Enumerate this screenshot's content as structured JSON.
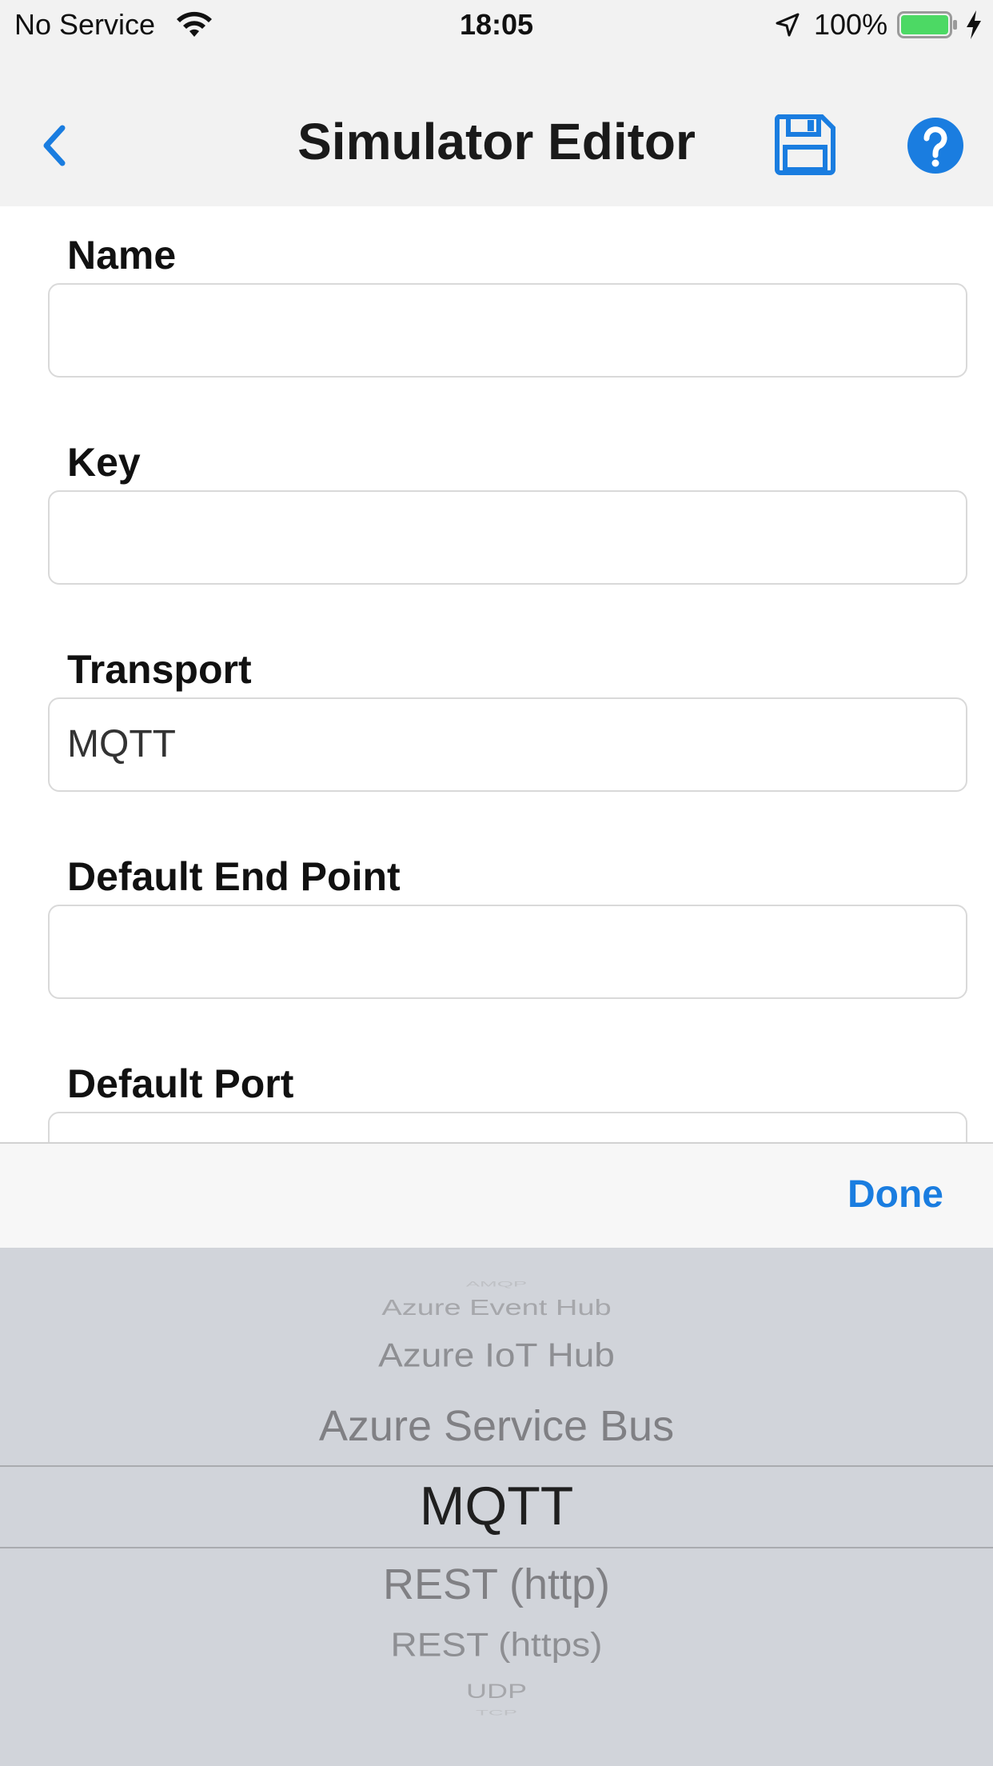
{
  "status_bar": {
    "carrier": "No Service",
    "time": "18:05",
    "battery_percent": "100%",
    "battery_color": "#4cd964"
  },
  "nav": {
    "title": "Simulator Editor",
    "back_icon": "chevron-left-icon",
    "save_icon": "floppy-disk-icon",
    "help_icon": "question-circle-icon",
    "accent_color": "#1a7de0"
  },
  "form": {
    "fields": [
      {
        "label": "Name",
        "value": ""
      },
      {
        "label": "Key",
        "value": ""
      },
      {
        "label": "Transport",
        "value": "MQTT"
      },
      {
        "label": "Default End Point",
        "value": ""
      },
      {
        "label": "Default Port",
        "value": ""
      }
    ]
  },
  "picker": {
    "done_label": "Done",
    "options": [
      "AMQP",
      "Azure Event Hub",
      "Azure IoT Hub",
      "Azure Service Bus",
      "MQTT",
      "REST (http)",
      "REST (https)",
      "UDP",
      "TCP"
    ],
    "selected": "MQTT"
  }
}
